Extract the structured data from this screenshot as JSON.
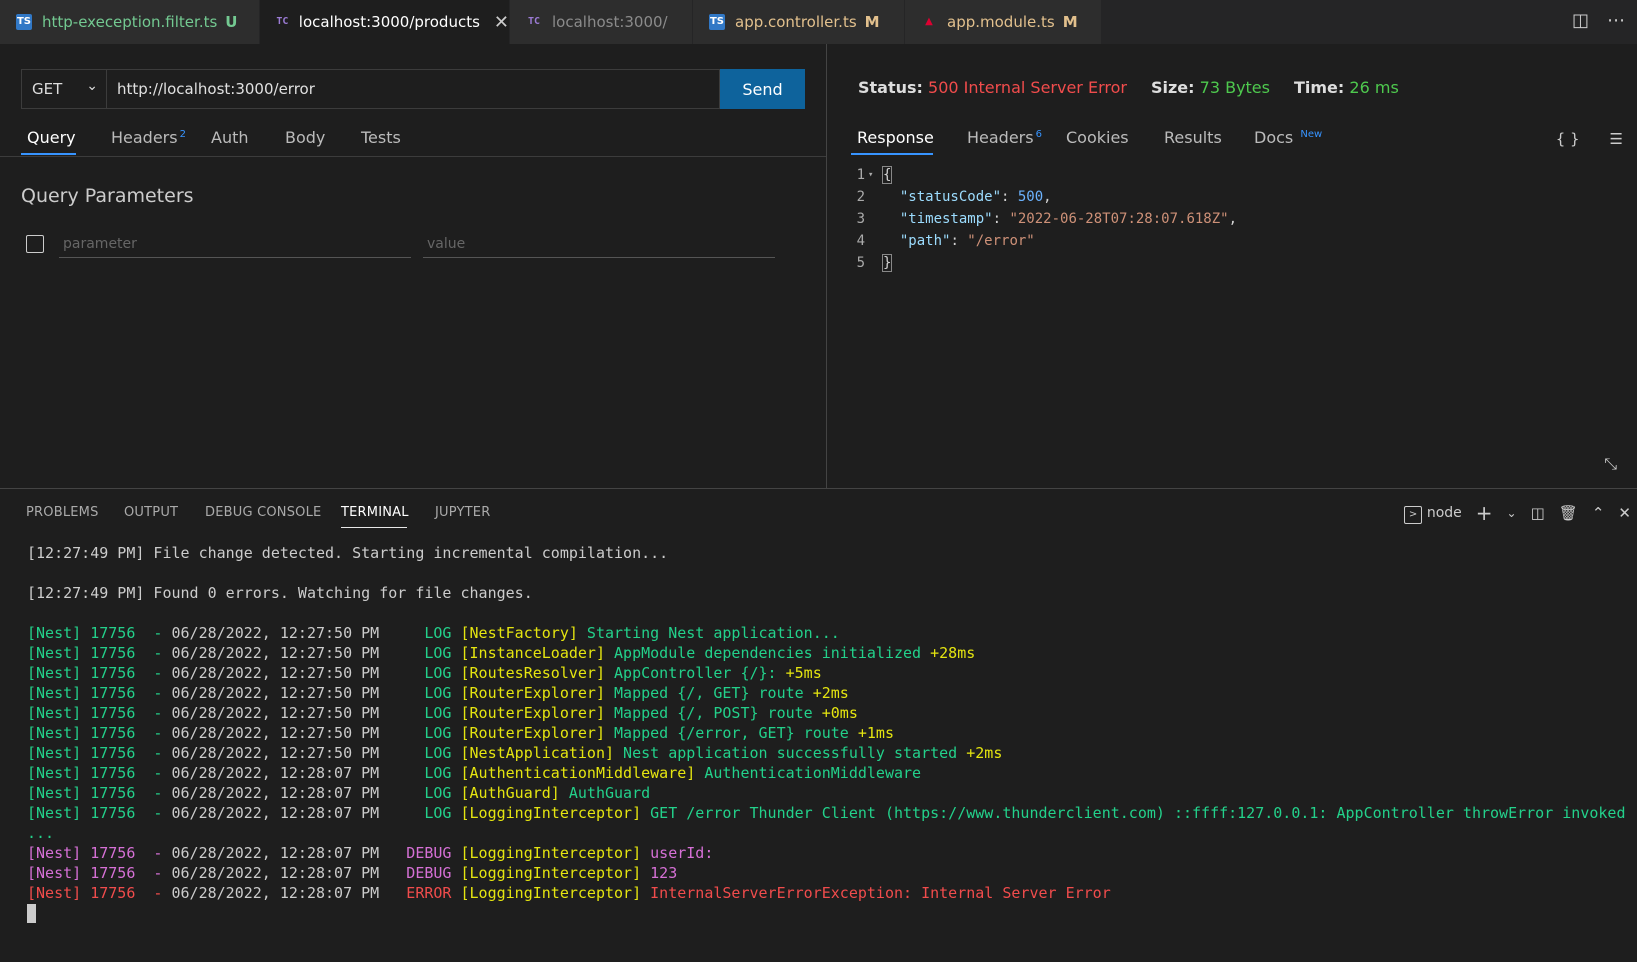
{
  "tabs": [
    {
      "label": "http-exeception.filter.ts",
      "badge": "U",
      "icon": "ts",
      "color": "#73c991"
    },
    {
      "label": "localhost:3000/products",
      "badge": "",
      "icon": "tc",
      "active": true
    },
    {
      "label": "localhost:3000/",
      "badge": "",
      "icon": "tc",
      "color": "#8b8b8b"
    },
    {
      "label": "app.controller.ts",
      "badge": "M",
      "icon": "ts",
      "color": "#e2c08d"
    },
    {
      "label": "app.module.ts",
      "badge": "M",
      "icon": "angular",
      "color": "#e2c08d"
    }
  ],
  "request": {
    "method": "GET",
    "url": "http://localhost:3000/error",
    "send_label": "Send",
    "tabs": {
      "query": "Query",
      "headers": "Headers",
      "headers_count": "2",
      "auth": "Auth",
      "body": "Body",
      "tests": "Tests"
    },
    "query_title": "Query Parameters",
    "param_placeholder": "parameter",
    "value_placeholder": "value"
  },
  "response": {
    "status_label": "Status:",
    "status_value": "500 Internal Server Error",
    "size_label": "Size:",
    "size_value": "73 Bytes",
    "time_label": "Time:",
    "time_value": "26 ms",
    "tabs": {
      "response": "Response",
      "headers": "Headers",
      "headers_count": "6",
      "cookies": "Cookies",
      "results": "Results",
      "docs": "Docs",
      "docs_badge": "New"
    },
    "format_icon": "{ }",
    "lines": {
      "l1": "{",
      "k2": "\"statusCode\"",
      "v2": "500",
      "k3": "\"timestamp\"",
      "v3": "\"2022-06-28T07:28:07.618Z\"",
      "k4": "\"path\"",
      "v4": "\"/error\"",
      "l5": "}"
    }
  },
  "panel": {
    "tabs": [
      "PROBLEMS",
      "OUTPUT",
      "DEBUG CONSOLE",
      "TERMINAL",
      "JUPYTER"
    ],
    "active_tab": "TERMINAL",
    "shell": "node"
  },
  "terminal": {
    "line1_time": "[12:27:49 PM]",
    "line1_text": " File change detected. Starting incremental compilation...",
    "line2_time": "[12:27:49 PM]",
    "line2_text": " Found 0 errors. Watching for file changes.",
    "logs": [
      {
        "prefix": "[Nest] 17756  - ",
        "date": "06/28/2022, 12:27:50 PM",
        "level": "     LOG",
        "ctx": "[NestFactory]",
        "msg": " Starting Nest application...",
        "extra": "",
        "kind": "log"
      },
      {
        "prefix": "[Nest] 17756  - ",
        "date": "06/28/2022, 12:27:50 PM",
        "level": "     LOG",
        "ctx": "[InstanceLoader]",
        "msg": " AppModule dependencies initialized",
        "extra": " +28ms",
        "kind": "log"
      },
      {
        "prefix": "[Nest] 17756  - ",
        "date": "06/28/2022, 12:27:50 PM",
        "level": "     LOG",
        "ctx": "[RoutesResolver]",
        "msg": " AppController {/}:",
        "extra": " +5ms",
        "kind": "log"
      },
      {
        "prefix": "[Nest] 17756  - ",
        "date": "06/28/2022, 12:27:50 PM",
        "level": "     LOG",
        "ctx": "[RouterExplorer]",
        "msg": " Mapped {/, GET} route",
        "extra": " +2ms",
        "kind": "log"
      },
      {
        "prefix": "[Nest] 17756  - ",
        "date": "06/28/2022, 12:27:50 PM",
        "level": "     LOG",
        "ctx": "[RouterExplorer]",
        "msg": " Mapped {/, POST} route",
        "extra": " +0ms",
        "kind": "log"
      },
      {
        "prefix": "[Nest] 17756  - ",
        "date": "06/28/2022, 12:27:50 PM",
        "level": "     LOG",
        "ctx": "[RouterExplorer]",
        "msg": " Mapped {/error, GET} route",
        "extra": " +1ms",
        "kind": "log"
      },
      {
        "prefix": "[Nest] 17756  - ",
        "date": "06/28/2022, 12:27:50 PM",
        "level": "     LOG",
        "ctx": "[NestApplication]",
        "msg": " Nest application successfully started",
        "extra": " +2ms",
        "kind": "log"
      },
      {
        "prefix": "[Nest] 17756  - ",
        "date": "06/28/2022, 12:28:07 PM",
        "level": "     LOG",
        "ctx": "[AuthenticationMiddleware]",
        "msg": " AuthenticationMiddleware",
        "extra": "",
        "kind": "log"
      },
      {
        "prefix": "[Nest] 17756  - ",
        "date": "06/28/2022, 12:28:07 PM",
        "level": "     LOG",
        "ctx": "[AuthGuard]",
        "msg": " AuthGuard",
        "extra": "",
        "kind": "log"
      },
      {
        "prefix": "[Nest] 17756  - ",
        "date": "06/28/2022, 12:28:07 PM",
        "level": "     LOG",
        "ctx": "[LoggingInterceptor]",
        "msg": " GET /error Thunder Client (https://www.thunderclient.com) ::ffff:127.0.0.1: AppController throwError invoked",
        "extra": "",
        "kind": "log"
      }
    ],
    "wrap": "...",
    "logs2": [
      {
        "prefix": "[Nest] 17756  - ",
        "date": "06/28/2022, 12:28:07 PM",
        "level": "   DEBUG",
        "ctx": "[LoggingInterceptor]",
        "msg": " userId:",
        "kind": "debug"
      },
      {
        "prefix": "[Nest] 17756  - ",
        "date": "06/28/2022, 12:28:07 PM",
        "level": "   DEBUG",
        "ctx": "[LoggingInterceptor]",
        "msg": " 123",
        "kind": "debug"
      },
      {
        "prefix": "[Nest] 17756  - ",
        "date": "06/28/2022, 12:28:07 PM",
        "level": "   ERROR",
        "ctx": "[LoggingInterceptor]",
        "msg": " InternalServerErrorException: Internal Server Error",
        "kind": "error"
      }
    ]
  }
}
